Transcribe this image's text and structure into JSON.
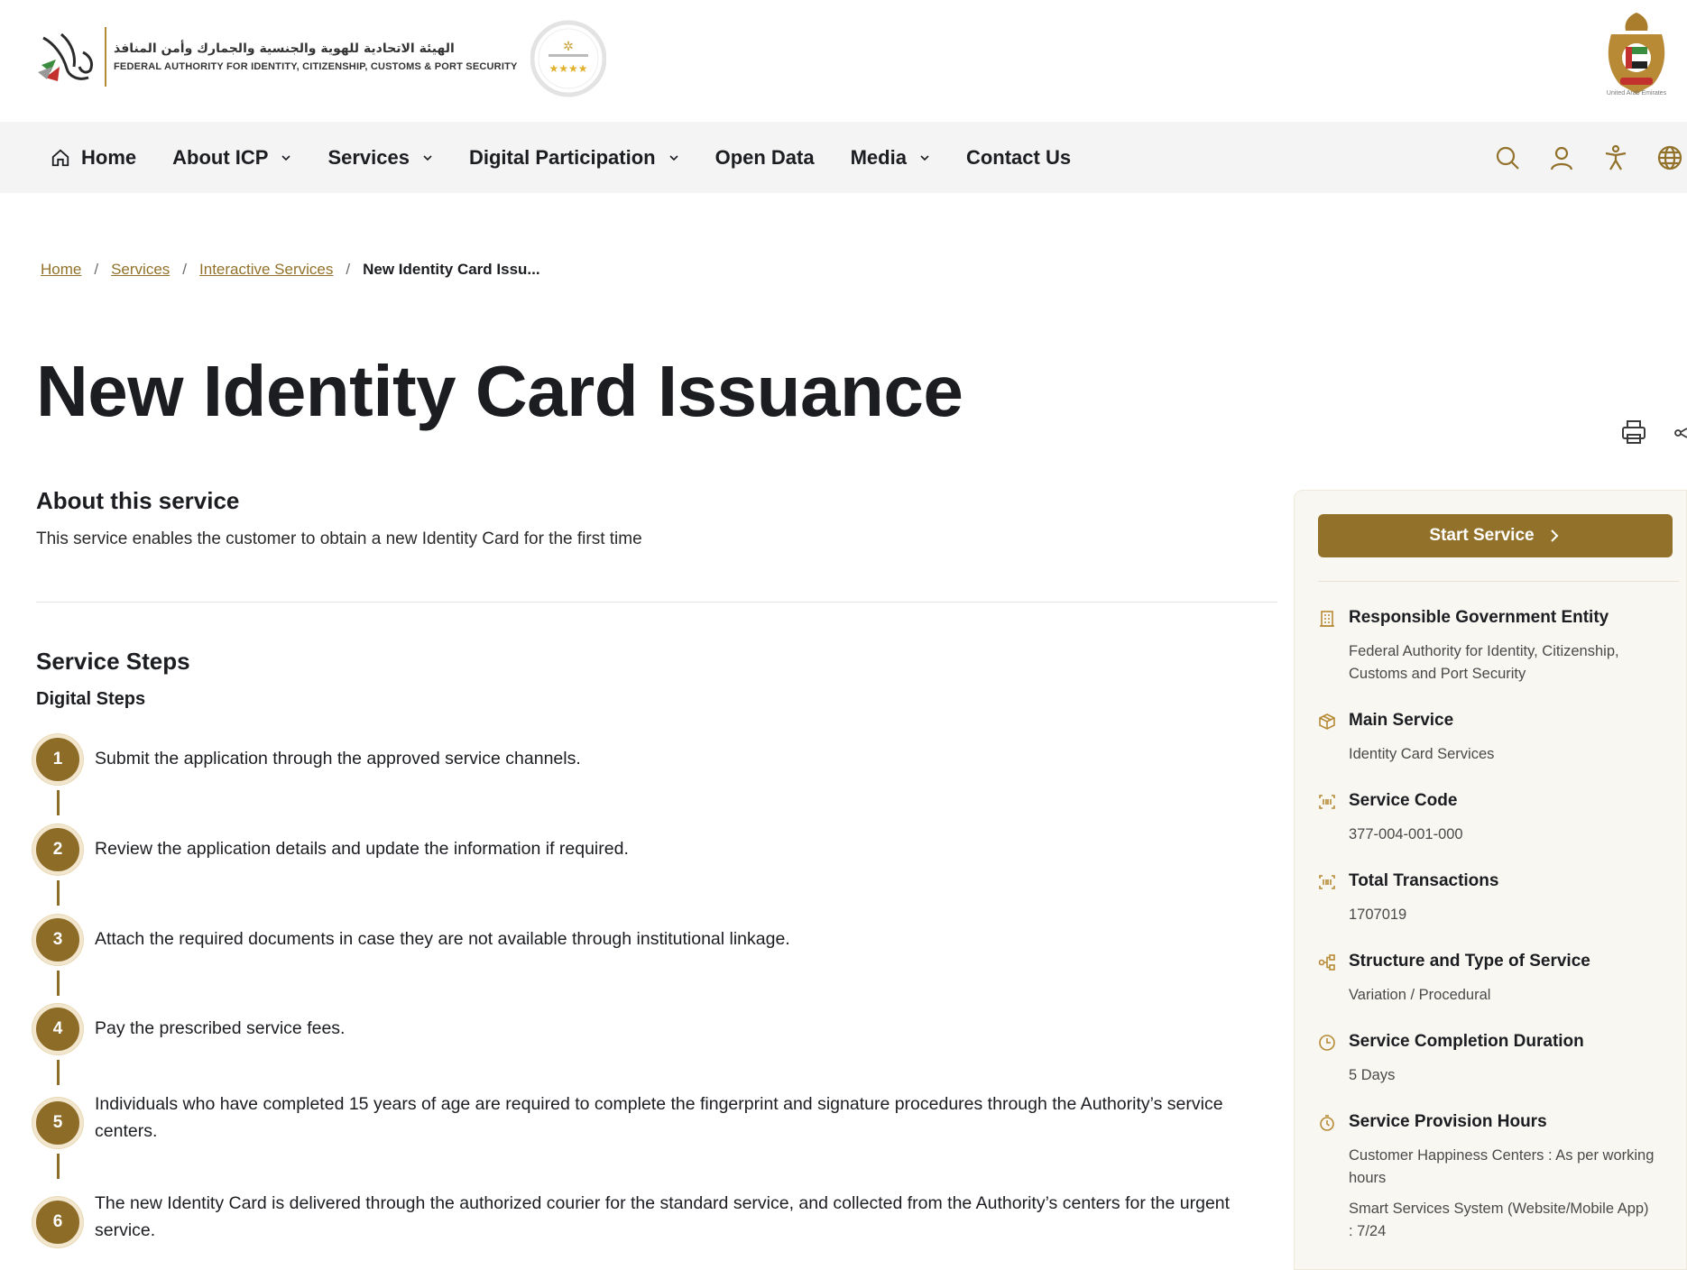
{
  "header": {
    "logo_arabic": "الهيئة الاتحادية للهوية والجنسية والجمارك وأمن المنافذ",
    "logo_english": "FEDERAL AUTHORITY FOR IDENTITY, CITIZENSHIP, CUSTOMS & PORT SECURITY",
    "emblem_caption": "United Arab Emirates"
  },
  "nav": {
    "items": [
      {
        "label": "Home",
        "icon": "home-icon",
        "has_dropdown": false
      },
      {
        "label": "About ICP",
        "has_dropdown": true
      },
      {
        "label": "Services",
        "has_dropdown": true
      },
      {
        "label": "Digital Participation",
        "has_dropdown": true
      },
      {
        "label": "Open Data",
        "has_dropdown": false
      },
      {
        "label": "Media",
        "has_dropdown": true
      },
      {
        "label": "Contact Us",
        "has_dropdown": false
      }
    ],
    "icons": [
      "search-icon",
      "user-icon",
      "accessibility-icon",
      "globe-icon"
    ]
  },
  "breadcrumb": {
    "items": [
      "Home",
      "Services",
      "Interactive Services"
    ],
    "current": "New Identity Card Issu..."
  },
  "page": {
    "title": "New Identity Card Issuance",
    "about_heading": "About this service",
    "about_text": "This service enables the customer to obtain a new Identity Card for the first time",
    "steps_heading": "Service Steps",
    "digital_heading": "Digital Steps",
    "steps": [
      {
        "num": "1",
        "text": "Submit the application through the approved service channels."
      },
      {
        "num": "2",
        "text": "Review the application details and update the information if required."
      },
      {
        "num": "3",
        "text": "Attach the required documents in case they are not available through institutional linkage."
      },
      {
        "num": "4",
        "text": "Pay the prescribed service fees."
      },
      {
        "num": "5",
        "text": "Individuals who have completed 15 years of age are required to complete the fingerprint and signature procedures through the Authority’s service centers."
      },
      {
        "num": "6",
        "text": "The new Identity Card is delivered through the authorized courier for the standard service, and collected from the Authority’s centers for the urgent service."
      }
    ]
  },
  "sidebar": {
    "start_label": "Start Service",
    "info": [
      {
        "title": "Responsible Government Entity",
        "icon": "building-icon",
        "value": "Federal Authority for Identity, Citizenship, Customs and Port Security"
      },
      {
        "title": "Main Service",
        "icon": "box-icon",
        "value": "Identity Card Services"
      },
      {
        "title": "Service Code",
        "icon": "barcode-icon",
        "value": "377-004-001-000"
      },
      {
        "title": "Total Transactions",
        "icon": "barcode-icon",
        "value": "1707019"
      },
      {
        "title": "Structure and Type of Service",
        "icon": "hierarchy-icon",
        "value": "Variation / Procedural"
      },
      {
        "title": "Service Completion Duration",
        "icon": "clock-icon",
        "value": "5 Days"
      },
      {
        "title": "Service Provision Hours",
        "icon": "stopwatch-icon",
        "value": "Customer Happiness Centers : As per working hours",
        "value2": "Smart Services System (Website/Mobile App) : 7/24"
      }
    ]
  },
  "colors": {
    "accent": "#92722a",
    "step_circle": "#8c6c27",
    "nav_bg": "#f4f4f5",
    "sidebar_bg": "#f9f7f2"
  }
}
